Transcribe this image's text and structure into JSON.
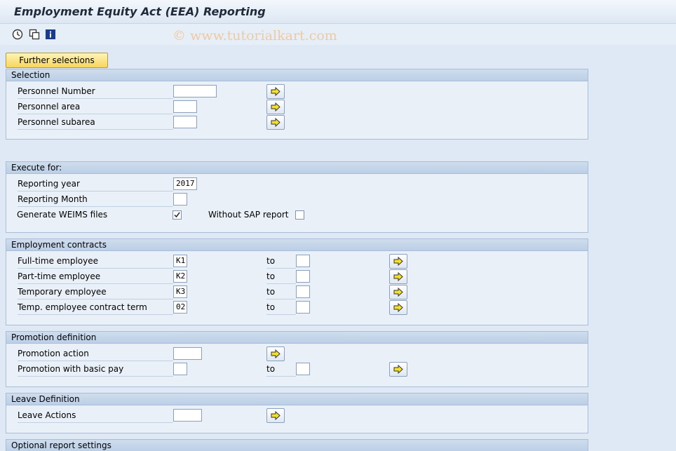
{
  "window": {
    "title": "Employment Equity Act (EEA) Reporting"
  },
  "watermark": "© www.tutorialkart.com",
  "toolbar": {
    "icons": [
      "execute-icon",
      "copy-icon",
      "info-icon"
    ]
  },
  "further_selections_label": "Further selections",
  "selection": {
    "header": "Selection",
    "personnel_number": "Personnel Number",
    "personnel_area": "Personnel area",
    "personnel_subarea": "Personnel subarea"
  },
  "execute_for": {
    "header": "Execute for:",
    "reporting_year_label": "Reporting year",
    "reporting_year_value": "2017",
    "reporting_month_label": "Reporting Month",
    "generate_weims_label": "Generate WEIMS files",
    "generate_weims_checked": true,
    "without_sap_label": "Without SAP report",
    "without_sap_checked": false
  },
  "employment_contracts": {
    "header": "Employment contracts",
    "to_label": "to",
    "rows": [
      {
        "label": "Full-time employee",
        "value": "K1"
      },
      {
        "label": "Part-time employee",
        "value": "K2"
      },
      {
        "label": "Temporary employee",
        "value": "K3"
      },
      {
        "label": "Temp. employee contract term",
        "value": "02"
      }
    ]
  },
  "promotion": {
    "header": "Promotion definition",
    "action_label": "Promotion action",
    "basic_pay_label": "Promotion with basic pay",
    "to_label": "to"
  },
  "leave": {
    "header": "Leave Definition",
    "actions_label": "Leave Actions"
  },
  "optional": {
    "header": "Optional report settings"
  },
  "colors": {
    "accent_button": "#f6d65c",
    "group_header": "#bccfe6",
    "background": "#dfe9f5"
  }
}
